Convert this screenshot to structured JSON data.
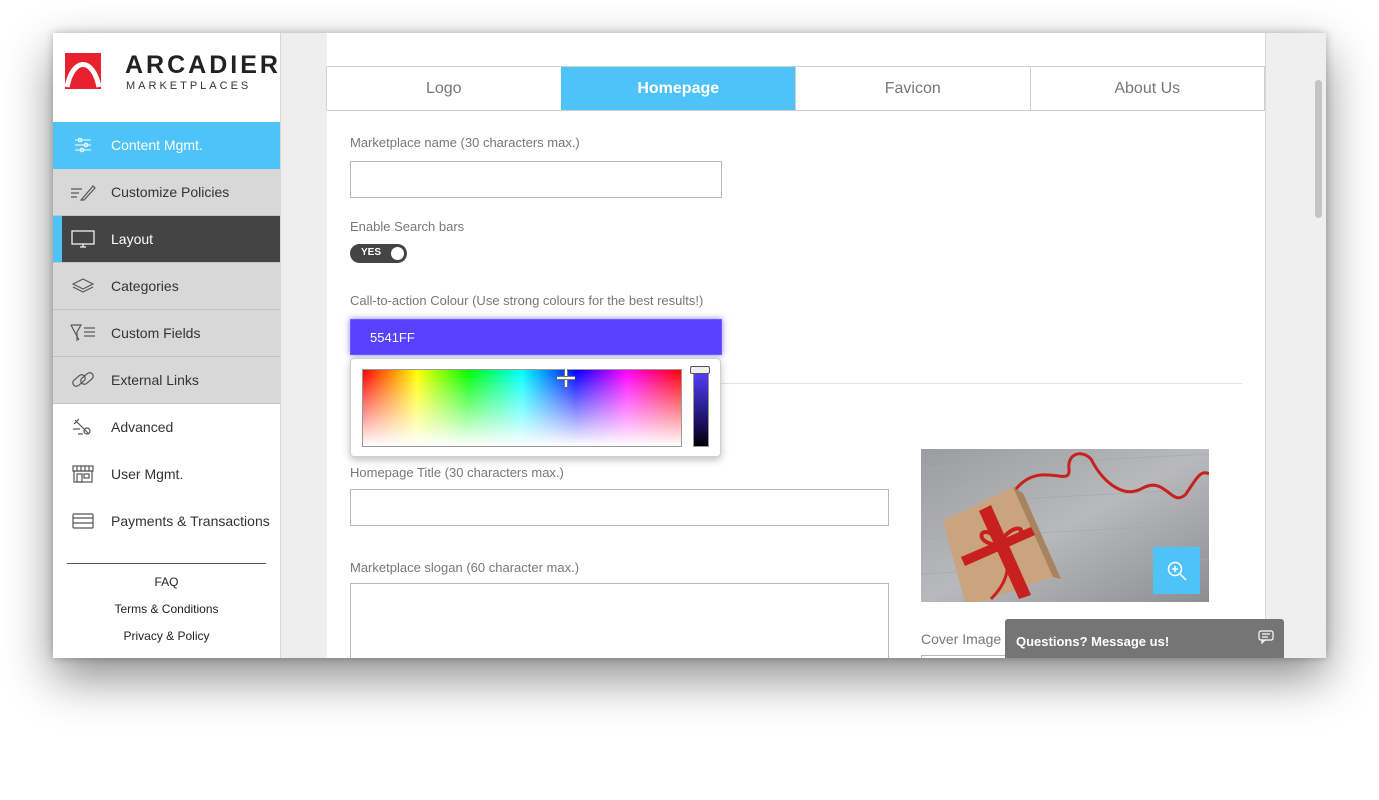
{
  "brand": {
    "name": "ARCADIER",
    "tagline": "MARKETPLACES"
  },
  "sidebar": {
    "items": [
      {
        "label": "Content Mgmt.",
        "icon": "sliders-icon"
      },
      {
        "label": "Customize Policies",
        "icon": "pen-lines-icon"
      },
      {
        "label": "Layout",
        "icon": "monitor-icon"
      },
      {
        "label": "Categories",
        "icon": "layers-icon"
      },
      {
        "label": "Custom Fields",
        "icon": "funnel-lines-icon"
      },
      {
        "label": "External Links",
        "icon": "link-icon"
      },
      {
        "label": "Advanced",
        "icon": "tools-icon"
      },
      {
        "label": "User Mgmt.",
        "icon": "storefront-icon"
      },
      {
        "label": "Payments & Transactions",
        "icon": "card-icon"
      }
    ],
    "footer_links": [
      "FAQ",
      "Terms & Conditions",
      "Privacy & Policy"
    ]
  },
  "tabs": [
    {
      "label": "Logo"
    },
    {
      "label": "Homepage",
      "active": true
    },
    {
      "label": "Favicon"
    },
    {
      "label": "About Us"
    }
  ],
  "form": {
    "marketplace_name_label": "Marketplace name   (30 characters max.)",
    "marketplace_name_value": "",
    "search_bars_label": "Enable Search bars",
    "search_bars_toggle": "YES",
    "cta_colour_label": "Call-to-action Colour   (Use strong colours for the best results!)",
    "cta_colour_value": "5541FF",
    "homepage_title_label": "Homepage Title (30 characters max.)",
    "homepage_title_value": "",
    "slogan_label": "Marketplace slogan (60 character max.)",
    "slogan_value": "",
    "cover_image_label": "Cover Image"
  },
  "chat": {
    "label": "Questions? Message us!"
  },
  "colors": {
    "accent": "#4ec3f7",
    "cta": "#5541ff",
    "dark_nav": "#444444"
  }
}
